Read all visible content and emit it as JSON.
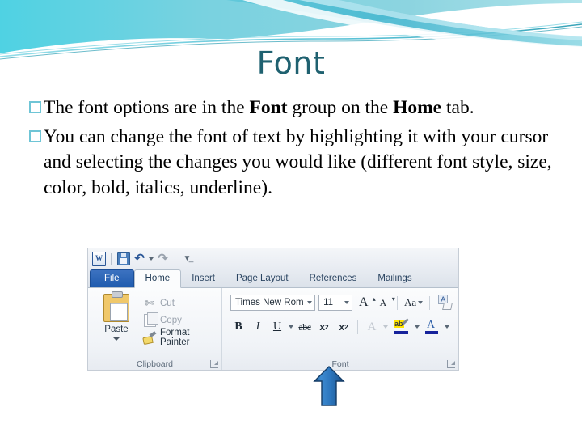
{
  "slide": {
    "title": "Font",
    "title_color": "#1F6170",
    "background_color": "#FFFFFF",
    "accent_colors": {
      "swoosh_light": "#BFEAF2",
      "swoosh_mid": "#6FC9DC",
      "swoosh_dark": "#2E9FB5",
      "bullet_square": "#6FC5D6",
      "arrow_fill": "#2E7CC4",
      "arrow_outline": "#1B4F82"
    },
    "bullets": [
      {
        "glyph": "open-square",
        "parts": [
          {
            "text": "The font options are in the ",
            "bold": false
          },
          {
            "text": "Font",
            "bold": true
          },
          {
            "text": " group on the ",
            "bold": false
          },
          {
            "text": "Home",
            "bold": true
          },
          {
            "text": " tab.",
            "bold": false
          }
        ],
        "plain": "The font options are in the Font group on the Home tab."
      },
      {
        "glyph": "open-square",
        "parts": [
          {
            "text": "You can change the font of text by highlighting it with your cursor and selecting the changes you would like (different font style, size, color, bold, italics, underline).",
            "bold": false
          }
        ],
        "plain": "You can change the font of text by highlighting it with your cursor and selecting the changes you would like (different font style, size, color, bold, italics, underline)."
      }
    ]
  },
  "ribbon_screenshot": {
    "quick_access": {
      "app_logo": "W",
      "items": [
        {
          "name": "save-icon",
          "label": "Save"
        },
        {
          "name": "undo-icon",
          "label": "Undo"
        },
        {
          "name": "undo-dropdown-caret",
          "label": ""
        },
        {
          "name": "redo-icon",
          "label": "Redo"
        },
        {
          "name": "customize-qat-caret",
          "label": ""
        }
      ]
    },
    "tabs": [
      {
        "label": "File",
        "active": false,
        "style": "file"
      },
      {
        "label": "Home",
        "active": true,
        "style": "normal"
      },
      {
        "label": "Insert",
        "active": false,
        "style": "normal"
      },
      {
        "label": "Page Layout",
        "active": false,
        "style": "normal"
      },
      {
        "label": "References",
        "active": false,
        "style": "normal"
      },
      {
        "label": "Mailings",
        "active": false,
        "style": "normal"
      }
    ],
    "clipboard_group": {
      "label": "Clipboard",
      "paste_label": "Paste",
      "items": [
        {
          "label": "Cut",
          "enabled": false
        },
        {
          "label": "Copy",
          "enabled": false
        },
        {
          "label": "Format Painter",
          "enabled": true
        }
      ]
    },
    "font_group": {
      "label": "Font",
      "font_name": "Times New Rom",
      "font_size": "11",
      "row1_buttons": [
        {
          "name": "grow-font",
          "glyph": "A"
        },
        {
          "name": "shrink-font",
          "glyph": "A"
        },
        {
          "name": "change-case",
          "glyph": "Aa"
        },
        {
          "name": "clear-formatting",
          "glyph": ""
        }
      ],
      "row2_buttons": [
        {
          "name": "bold",
          "glyph": "B"
        },
        {
          "name": "italic",
          "glyph": "I"
        },
        {
          "name": "underline",
          "glyph": "U"
        },
        {
          "name": "strikethrough",
          "glyph": "abc"
        },
        {
          "name": "subscript",
          "glyph": "x",
          "script": "2"
        },
        {
          "name": "superscript",
          "glyph": "x",
          "script": "2"
        },
        {
          "name": "text-effects",
          "glyph": "A"
        },
        {
          "name": "text-highlight-color",
          "glyph": "ab"
        },
        {
          "name": "font-color",
          "glyph": "A"
        }
      ]
    }
  },
  "annotation": {
    "arrow_name": "up-arrow-pointing-to-font-group",
    "points_at": "Font"
  }
}
